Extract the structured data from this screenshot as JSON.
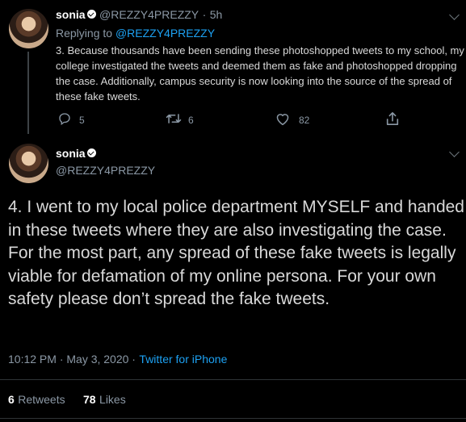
{
  "tweet1": {
    "name": "sonia",
    "handle": "@REZZY4PREZZY",
    "time_sep": "·",
    "time": "5h",
    "replying_prefix": "Replying to",
    "replying_handle": "@REZZY4PREZZY",
    "text": "3. Because thousands have been sending these photoshopped tweets to my school, my college investigated the tweets and deemed them as fake and photoshopped dropping the case. Additionally, campus security is now looking into the source of the spread of these fake tweets.",
    "reply_count": "5",
    "retweet_count": "6",
    "like_count": "82"
  },
  "tweet2": {
    "name": "sonia",
    "handle": "@REZZY4PREZZY",
    "text": "4. I went to my local police department MYSELF and handed in these tweets where they are also investigating the case. For the most part, any spread of these fake tweets is legally viable for defamation of my online persona. For your own safety please don’t spread the fake tweets.",
    "timestamp": "10:12 PM · May 3, 2020 ·",
    "source": "Twitter for iPhone",
    "retweets_num": "6",
    "retweets_label": "Retweets",
    "likes_num": "78",
    "likes_label": "Likes"
  },
  "icons": {
    "reply": "reply-icon",
    "retweet": "retweet-icon",
    "like": "heart-icon",
    "share": "share-icon",
    "more": "chevron-down-icon",
    "verified": "verified-badge-icon"
  },
  "colors": {
    "background": "#000000",
    "text": "#d9d9d9",
    "secondary": "#8b98a5",
    "link": "#1da1f2"
  }
}
